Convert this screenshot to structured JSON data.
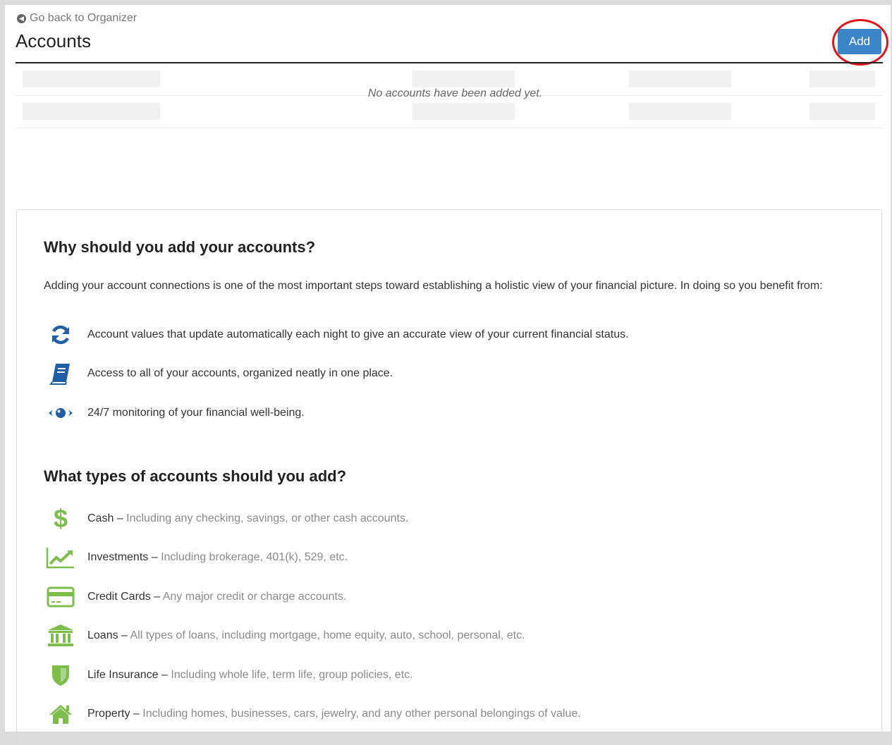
{
  "header": {
    "back_link": "Go back to Organizer",
    "title": "Accounts",
    "add_label": "Add"
  },
  "accounts_table": {
    "empty_message": "No accounts have been added yet."
  },
  "why": {
    "heading": "Why should you add your accounts?",
    "intro": "Adding your account connections is one of the most important steps toward establishing a holistic view of your financial picture. In doing so you benefit from:",
    "benefits": [
      {
        "icon": "refresh-icon",
        "text": "Account values that update automatically each night to give an accurate view of your current financial status."
      },
      {
        "icon": "book-icon",
        "text": "Access to all of your accounts, organized neatly in one place."
      },
      {
        "icon": "eye-icon",
        "text": "24/7 monitoring of your financial well-being."
      }
    ]
  },
  "types": {
    "heading": "What types of accounts should you add?",
    "items": [
      {
        "icon": "dollar-icon",
        "name": "Cash",
        "sep": " – ",
        "desc": "Including any checking, savings, or other cash accounts."
      },
      {
        "icon": "line-chart-icon",
        "name": "Investments",
        "sep": " – ",
        "desc": "Including brokerage, 401(k), 529, etc."
      },
      {
        "icon": "credit-card-icon",
        "name": "Credit Cards",
        "sep": " – ",
        "desc": "Any major credit or charge accounts."
      },
      {
        "icon": "bank-icon",
        "name": "Loans",
        "sep": " – ",
        "desc": "All types of loans, including mortgage, home equity, auto, school, personal, etc."
      },
      {
        "icon": "shield-icon",
        "name": "Life Insurance",
        "sep": " – ",
        "desc": "Including whole life, term life, group policies, etc."
      },
      {
        "icon": "home-icon",
        "name": "Property",
        "sep": " – ",
        "desc": "Including homes, businesses, cars, jewelry, and any other personal belongings of value."
      }
    ]
  },
  "colors": {
    "accent": "#3c86c8",
    "benefit_icon": "#1f5fa6",
    "type_icon": "#7dbd4c",
    "highlight": "#e0141a"
  }
}
